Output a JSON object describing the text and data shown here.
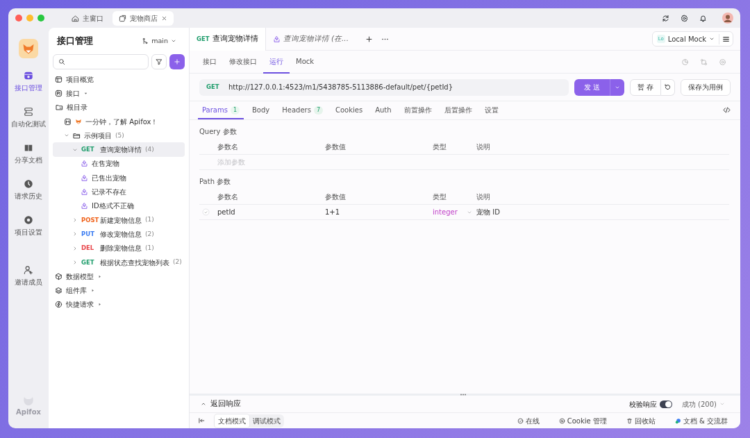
{
  "window_tabs": [
    {
      "label": "主窗口",
      "kind": "home",
      "selected": false
    },
    {
      "label": "宠物商店",
      "kind": "project",
      "selected": true
    }
  ],
  "rail": {
    "items": [
      {
        "label": "接口管理",
        "kind": "api",
        "selected": true
      },
      {
        "label": "自动化测试",
        "kind": "flow",
        "selected": false
      },
      {
        "label": "分享文档",
        "kind": "book",
        "selected": false
      },
      {
        "label": "请求历史",
        "kind": "clock",
        "selected": false
      },
      {
        "label": "项目设置",
        "kind": "gear",
        "selected": false
      },
      {
        "label": "邀请成员",
        "kind": "invite",
        "selected": false
      }
    ],
    "brand": "Apifox"
  },
  "sidebar": {
    "title": "接口管理",
    "branch": "main",
    "sections": [
      {
        "label": "项目概览",
        "kind": "overview"
      },
      {
        "label": "接口",
        "kind": "api",
        "expanded": true,
        "children": [
          {
            "label": "根目录",
            "kind": "root",
            "children": [
              {
                "label": "一分钟，了解 Apifox！",
                "kind": "doc"
              },
              {
                "label": "示例项目",
                "kind": "folder",
                "count": "(5)",
                "expanded": true,
                "children": [
                  {
                    "method": "GET",
                    "color": "#1f9d6c",
                    "label": "查询宠物详情",
                    "count": "(4)",
                    "expanded": true,
                    "selected": true,
                    "children": [
                      {
                        "label": "在售宠物",
                        "kind": "case"
                      },
                      {
                        "label": "已售出宠物",
                        "kind": "case"
                      },
                      {
                        "label": "记录不存在",
                        "kind": "case"
                      },
                      {
                        "label": "ID格式不正确",
                        "kind": "case"
                      }
                    ]
                  },
                  {
                    "method": "POST",
                    "color": "#f0631c",
                    "label": "新建宠物信息",
                    "count": "(1)",
                    "expanded": false,
                    "selected": false
                  },
                  {
                    "method": "PUT",
                    "color": "#3b7cf2",
                    "label": "修改宠物信息",
                    "count": "(2)",
                    "expanded": false,
                    "selected": false
                  },
                  {
                    "method": "DEL",
                    "color": "#e8454a",
                    "label": "删除宠物信息",
                    "count": "(1)",
                    "expanded": false,
                    "selected": false
                  },
                  {
                    "method": "GET",
                    "color": "#1f9d6c",
                    "label": "根据状态查找宠物列表",
                    "count": "(2)",
                    "expanded": false,
                    "selected": false
                  }
                ]
              }
            ]
          }
        ]
      },
      {
        "label": "数据模型",
        "kind": "model",
        "expanded": false
      },
      {
        "label": "组件库",
        "kind": "library",
        "expanded": false
      },
      {
        "label": "快捷请求",
        "kind": "quick",
        "expanded": false
      }
    ]
  },
  "doc_tabs": [
    {
      "method": "GET",
      "label": "查询宠物详情",
      "kind": "endpoint",
      "selected": true
    },
    {
      "label": "查询宠物详情 (在...",
      "kind": "case",
      "selected": false
    }
  ],
  "environment": {
    "badge": "Lo",
    "label": "Local Mock"
  },
  "sub_tabs": [
    {
      "label": "接口",
      "selected": false
    },
    {
      "label": "修改接口",
      "selected": false
    },
    {
      "label": "运行",
      "selected": true
    },
    {
      "label": "Mock",
      "selected": false
    }
  ],
  "request": {
    "method": "GET",
    "url": "http://127.0.0.1:4523/m1/5438785-5113886-default/pet/{petId}",
    "send": "发 送",
    "save": "暂 存",
    "save_case": "保存为用例"
  },
  "param_tabs": [
    {
      "label": "Params",
      "count": "1",
      "selected": true
    },
    {
      "label": "Body",
      "selected": false
    },
    {
      "label": "Headers",
      "count": "7",
      "selected": false
    },
    {
      "label": "Cookies",
      "selected": false
    },
    {
      "label": "Auth",
      "selected": false
    },
    {
      "label": "前置操作",
      "selected": false
    },
    {
      "label": "后置操作",
      "selected": false
    },
    {
      "label": "设置",
      "selected": false
    }
  ],
  "query": {
    "title": "Query 参数",
    "columns": [
      "参数名",
      "参数值",
      "类型",
      "说明"
    ],
    "placeholder": "添加参数"
  },
  "path": {
    "title": "Path 参数",
    "columns": [
      "参数名",
      "参数值",
      "类型",
      "说明"
    ],
    "rows": [
      {
        "name": "petId",
        "value": "1+1",
        "type": "integer",
        "description": "宠物 ID",
        "checked": true
      }
    ]
  },
  "response": {
    "title": "返回响应",
    "validate_label": "校验响应",
    "validate_on": true,
    "status": "成功 (200)"
  },
  "bottom_bar": {
    "modes": [
      {
        "label": "文档模式",
        "selected": true
      },
      {
        "label": "调试模式",
        "selected": false
      }
    ],
    "items": [
      {
        "label": "在线",
        "kind": "online"
      },
      {
        "label": "Cookie 管理",
        "kind": "cookie"
      },
      {
        "label": "回收站",
        "kind": "trash"
      },
      {
        "label": "文档 & 交流群",
        "kind": "chat"
      }
    ]
  }
}
